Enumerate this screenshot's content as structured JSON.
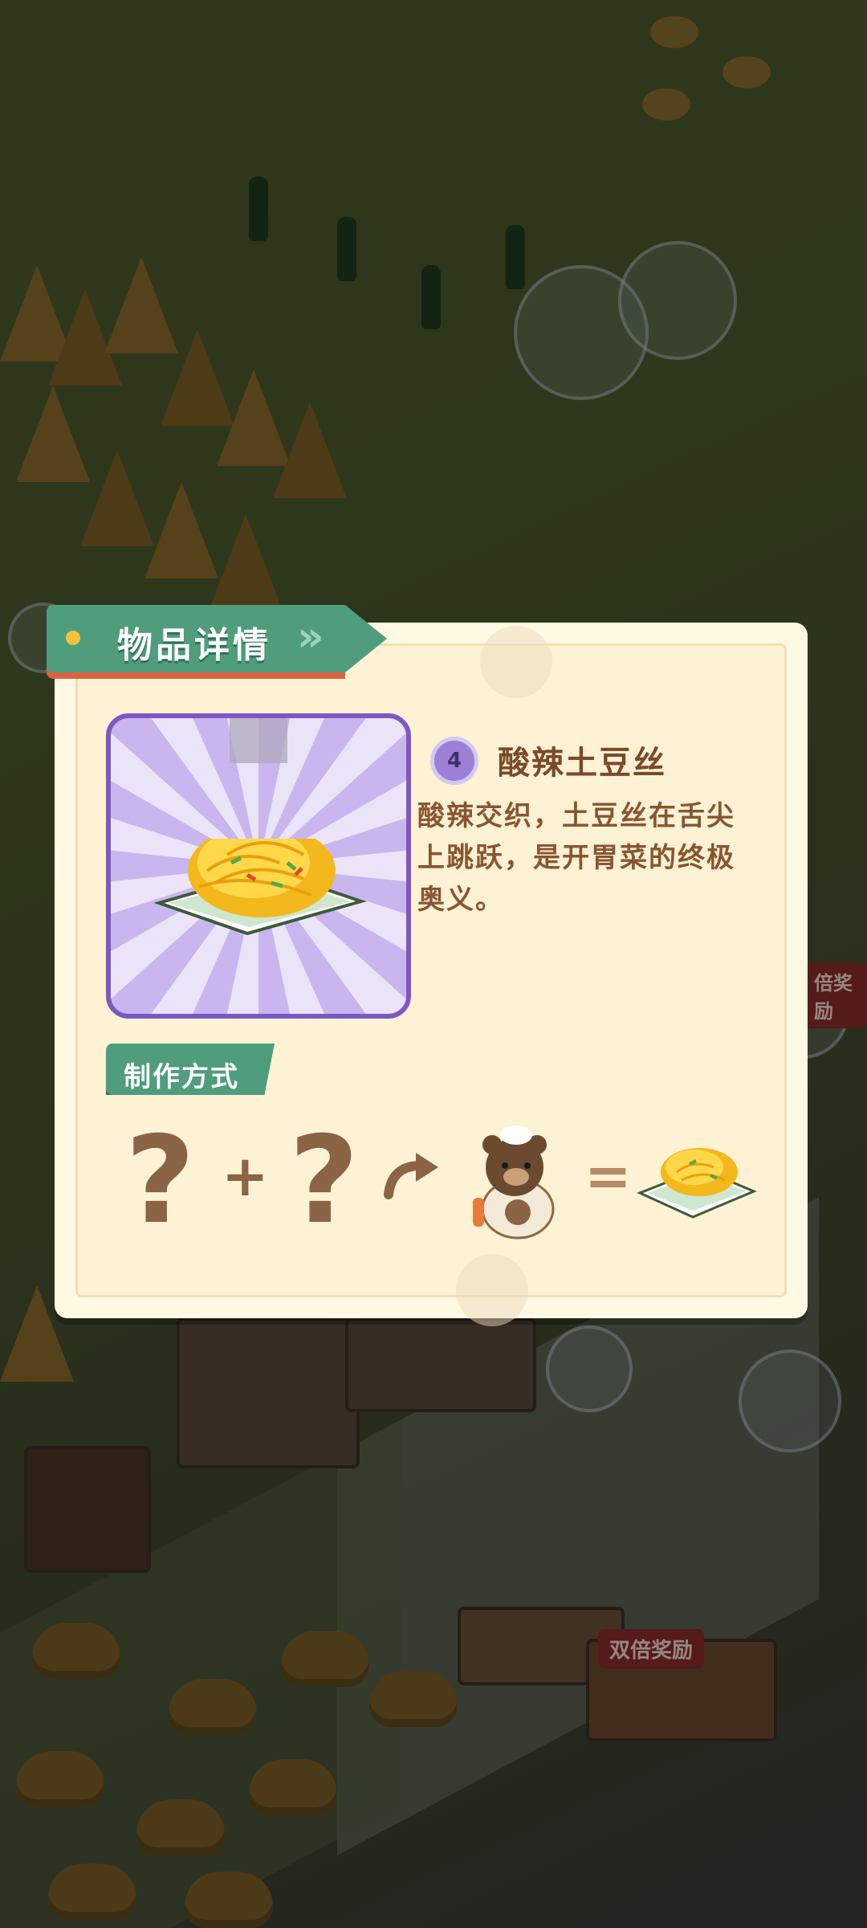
{
  "dialog": {
    "title": "物品详情",
    "item": {
      "name": "酸辣土豆丝",
      "level": "4",
      "description": "酸辣交织，土豆丝在舌尖上跳跃，是开胃菜的终极奥义。"
    },
    "crafting": {
      "label": "制作方式",
      "unknown_1": "?",
      "plus": "+",
      "unknown_2": "?",
      "equals": "="
    }
  },
  "background": {
    "reward_badge_1": "双倍奖励",
    "reward_badge_2": "倍奖励"
  },
  "icons": {
    "item": "shredded-potato-dish-icon",
    "arrow": "curved-arrow-icon",
    "chef": "bear-chef-icon",
    "result": "shredded-potato-dish-icon"
  },
  "colors": {
    "ribbon": "#4f9d7d",
    "ribbon_accent": "#d8633f",
    "card_border": "#7d58c2",
    "text_brown": "#7a4a2a",
    "panel_bg": "#fff8e2"
  }
}
